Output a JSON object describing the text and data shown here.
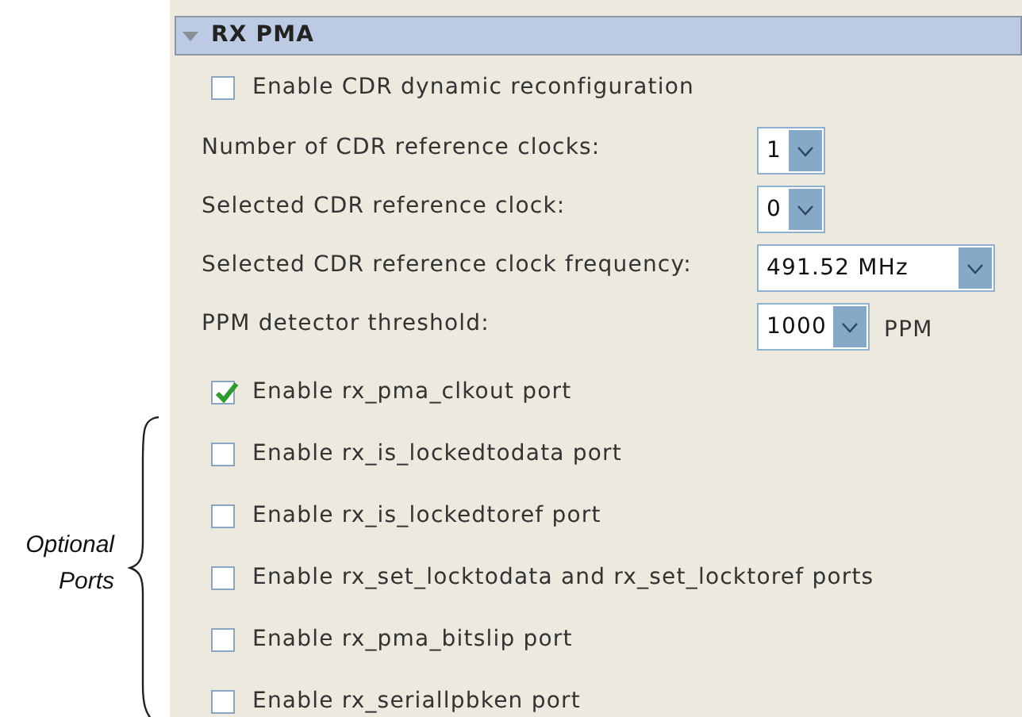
{
  "section": {
    "title": "RX PMA",
    "expanded": true
  },
  "settings": [
    {
      "kind": "checkbox",
      "label": "Enable CDR dynamic reconfiguration",
      "checked": false
    },
    {
      "kind": "select",
      "label": "Number of CDR reference clocks:",
      "value": "1"
    },
    {
      "kind": "select",
      "label": "Selected CDR reference clock:",
      "value": "0"
    },
    {
      "kind": "select",
      "label": "Selected CDR reference clock frequency:",
      "value": "491.52 MHz",
      "wide": true
    },
    {
      "kind": "select",
      "label": "PPM detector threshold:",
      "value": "1000",
      "unit": "PPM"
    }
  ],
  "ports": [
    {
      "label": "Enable rx_pma_clkout port",
      "checked": true
    },
    {
      "label": "Enable rx_is_lockedtodata port",
      "checked": false
    },
    {
      "label": "Enable rx_is_lockedtoref port",
      "checked": false
    },
    {
      "label": "Enable rx_set_locktodata and rx_set_locktoref ports",
      "checked": false
    },
    {
      "label": "Enable rx_pma_bitslip port",
      "checked": false
    },
    {
      "label": "Enable rx_seriallpbken port",
      "checked": false
    }
  ],
  "annotation": {
    "text": "Optional Ports"
  }
}
